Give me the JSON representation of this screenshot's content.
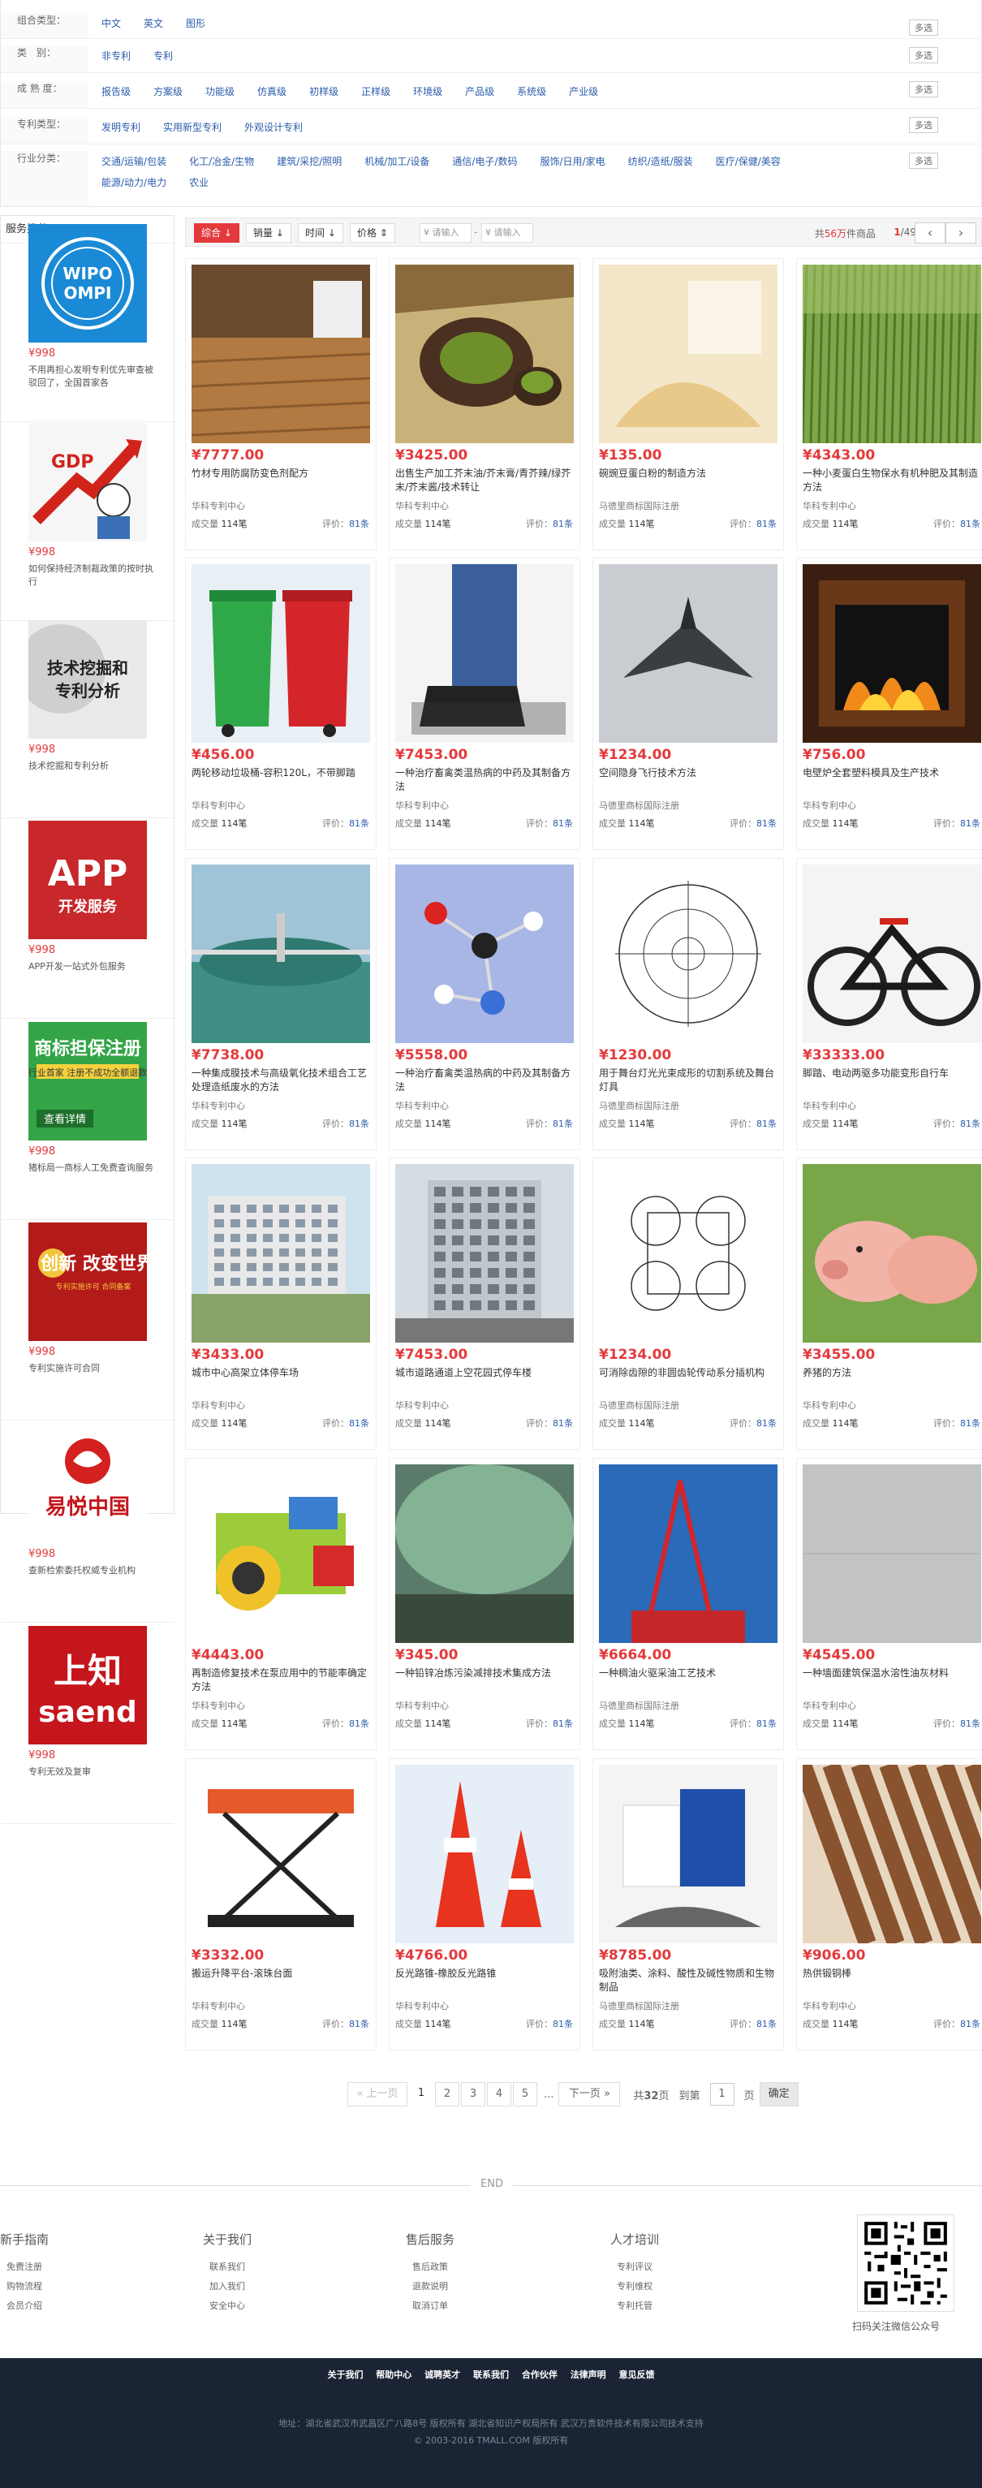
{
  "filters": {
    "rows": [
      {
        "label": "组合类型：",
        "options": [
          "中文",
          "英文",
          "图形"
        ],
        "more": "多选"
      },
      {
        "label": "类　别：",
        "options": [
          "非专利",
          "专利"
        ],
        "more": "多选"
      },
      {
        "label": "成 熟 度：",
        "options": [
          "报告级",
          "方案级",
          "功能级",
          "仿真级",
          "初样级",
          "正样级",
          "环境级",
          "产品级",
          "系统级",
          "产业级"
        ],
        "more": "多选"
      },
      {
        "label": "专利类型：",
        "options": [
          "发明专利",
          "实用新型专利",
          "外观设计专利"
        ],
        "more": "多选"
      },
      {
        "label": "行业分类：",
        "options": [
          "交通/运输/包装",
          "化工/冶金/生物",
          "建筑/采挖/照明",
          "机械/加工/设备",
          "通信/电子/数码",
          "服饰/日用/家电",
          "纺织/造纸/服装",
          "医疗/保健/美容",
          "能源/动力/电力",
          "农业"
        ],
        "more": "多选"
      }
    ]
  },
  "sidebar": {
    "title": "服务推荐",
    "items": [
      {
        "price": "¥998",
        "desc": "不用再担心发明专利优先审查被驳回了，全国首家各"
      },
      {
        "price": "¥998",
        "desc": "如何保持经济制裁政策的按时执行"
      },
      {
        "price": "¥998",
        "desc": "技术挖掘和专利分析"
      },
      {
        "price": "¥998",
        "desc": "APP开发一站式外包服务"
      },
      {
        "price": "¥998",
        "desc": "猪标局一商标人工免费查询服务"
      },
      {
        "price": "¥998",
        "desc": "专利实施许可合同"
      },
      {
        "price": "¥998",
        "desc": "查新检索委托权威专业机构"
      },
      {
        "price": "¥998",
        "desc": "专利无效及复审"
      }
    ],
    "images": [
      {
        "text": "WIPO OMPI",
        "bg": "#1a8ad6"
      },
      {
        "text": "GDP",
        "bg": "#f4f4f4"
      },
      {
        "text": "技术挖掘和专利分析",
        "bg": "#e8e8e8"
      },
      {
        "text": "APP 开发服务",
        "bg": "#c8282b"
      },
      {
        "text": "商标担保注册",
        "bg": "#2a9a3e"
      },
      {
        "text": "创新 改变世界",
        "bg": "#b31a1a"
      },
      {
        "text": "易悦中国",
        "bg": "#ffffff"
      },
      {
        "text": "上知 saend",
        "bg": "#c4161c"
      }
    ]
  },
  "toolbar": {
    "sort_comprehensive": "综合",
    "sort_sales": "销量",
    "sort_time": "时间",
    "sort_price": "价格",
    "price_min_placeholder": "¥ 请输入",
    "price_max_placeholder": "¥ 请输入",
    "count_prefix": "共",
    "count_value": "56万",
    "count_suffix": "件商品",
    "page_current": "1",
    "page_total": "/49",
    "prev": "‹",
    "next": "›"
  },
  "products": [
    {
      "price": "¥7777.00",
      "title": "竹材专用防腐防变色剂配方",
      "shop": "华科专利中心",
      "deals": "114笔",
      "rating": "81条",
      "img": "wood"
    },
    {
      "price": "¥3425.00",
      "title": "出售生产加工芥末油/芥末膏/青芥辣/绿芥末/芥末酱/技术转让",
      "shop": "华科专利中心",
      "deals": "114笔",
      "rating": "81条",
      "img": "matcha"
    },
    {
      "price": "¥135.00",
      "title": "碗豌豆蛋白粉的制造方法",
      "shop": "马德里商标国际注册",
      "deals": "114笔",
      "rating": "81条",
      "img": "powder"
    },
    {
      "price": "¥4343.00",
      "title": "一种小麦蛋白生物保水有机种肥及其制造方法",
      "shop": "华科专利中心",
      "deals": "114笔",
      "rating": "81条",
      "img": "wheat"
    },
    {
      "price": "¥456.00",
      "title": "两轮移动垃圾桶-容积120L，不带脚踏",
      "shop": "华科专利中心",
      "deals": "114笔",
      "rating": "81条",
      "img": "bins"
    },
    {
      "price": "¥7453.00",
      "title": "一种治疗畜禽类温热病的中药及其制备方法",
      "shop": "华科专利中心",
      "deals": "114笔",
      "rating": "81条",
      "img": "boots"
    },
    {
      "price": "¥1234.00",
      "title": "空间隐身飞行技术方法",
      "shop": "马德里商标国际注册",
      "deals": "114笔",
      "rating": "81条",
      "img": "jet"
    },
    {
      "price": "¥756.00",
      "title": "电壁炉全套塑料模具及生产技术",
      "shop": "华科专利中心",
      "deals": "114笔",
      "rating": "81条",
      "img": "fire"
    },
    {
      "price": "¥7738.00",
      "title": "一种集成膜技术与高级氧化技术组合工艺处理造纸废水的方法",
      "shop": "华科专利中心",
      "deals": "114笔",
      "rating": "81条",
      "img": "water"
    },
    {
      "price": "¥5558.00",
      "title": "一种治疗畜禽类温热病的中药及其制备方法",
      "shop": "华科专利中心",
      "deals": "114笔",
      "rating": "81条",
      "img": "molecule"
    },
    {
      "price": "¥1230.00",
      "title": "用于舞台灯光光束成形的切割系统及舞台灯具",
      "shop": "马德里商标国际注册",
      "deals": "114笔",
      "rating": "81条",
      "img": "drawing"
    },
    {
      "price": "¥33333.00",
      "title": "脚踏、电动两驱多功能变形自行车",
      "shop": "华科专利中心",
      "deals": "114笔",
      "rating": "81条",
      "img": "bike"
    },
    {
      "price": "¥3433.00",
      "title": "城市中心高架立体停车场",
      "shop": "华科专利中心",
      "deals": "114笔",
      "rating": "81条",
      "img": "building1"
    },
    {
      "price": "¥7453.00",
      "title": "城市道路通道上空花园式停车楼",
      "shop": "华科专利中心",
      "deals": "114笔",
      "rating": "81条",
      "img": "building2"
    },
    {
      "price": "¥1234.00",
      "title": "可消除齿隙的非圆齿轮传动系分插机构",
      "shop": "马德里商标国际注册",
      "deals": "114笔",
      "rating": "81条",
      "img": "gears"
    },
    {
      "price": "¥3455.00",
      "title": "养猪的方法",
      "shop": "华科专利中心",
      "deals": "114笔",
      "rating": "81条",
      "img": "pigs"
    },
    {
      "price": "¥4443.00",
      "title": "再制造修复技术在泵应用中的节能率确定方法",
      "shop": "华科专利中心",
      "deals": "114笔",
      "rating": "81条",
      "img": "pump"
    },
    {
      "price": "¥345.00",
      "title": "一种铅锌冶炼污染减排技术集成方法",
      "shop": "华科专利中心",
      "deals": "114笔",
      "rating": "81条",
      "img": "smoke"
    },
    {
      "price": "¥6664.00",
      "title": "一种稠油火驱采油工艺技术",
      "shop": "马德里商标国际注册",
      "deals": "114笔",
      "rating": "81条",
      "img": "rig"
    },
    {
      "price": "¥4545.00",
      "title": "一种墙面建筑保温水溶性油灰材料",
      "shop": "华科专利中心",
      "deals": "114笔",
      "rating": "81条",
      "img": "wall"
    },
    {
      "price": "¥3332.00",
      "title": "搬运升降平台-滚珠台面",
      "shop": "华科专利中心",
      "deals": "114笔",
      "rating": "81条",
      "img": "lift"
    },
    {
      "price": "¥4766.00",
      "title": "反光路锥-橡胶反光路锥",
      "shop": "华科专利中心",
      "deals": "114笔",
      "rating": "81条",
      "img": "cones"
    },
    {
      "price": "¥8785.00",
      "title": "吸附油类、涂料、酸性及碱性物质和生物制品",
      "shop": "马德里商标国际注册",
      "deals": "114笔",
      "rating": "81条",
      "img": "bags"
    },
    {
      "price": "¥906.00",
      "title": "热供锻铜棒",
      "shop": "华科专利中心",
      "deals": "114笔",
      "rating": "81条",
      "img": "rods"
    }
  ],
  "product_labels": {
    "deal_prefix": "成交量",
    "rating_prefix": "评价："
  },
  "pagination": {
    "prev": "上一页",
    "pages": [
      "1",
      "2",
      "3",
      "4",
      "5"
    ],
    "ellipsis": "...",
    "next": "下一页",
    "total_prefix": "共",
    "total_value": "32",
    "total_suffix": "页",
    "goto_prefix": "到第",
    "goto_value": "1",
    "goto_suffix": "页",
    "confirm": "确定"
  },
  "end_label": "END",
  "footer": {
    "columns": [
      {
        "title": "新手指南",
        "links": [
          "免费注册",
          "购物流程",
          "会员介绍"
        ]
      },
      {
        "title": "关于我们",
        "links": [
          "联系我们",
          "加入我们",
          "安全中心"
        ]
      },
      {
        "title": "售后服务",
        "links": [
          "售后政策",
          "退款说明",
          "取消订单"
        ]
      },
      {
        "title": "人才培训",
        "links": [
          "专利评议",
          "专利维权",
          "专利托管"
        ]
      }
    ],
    "qr_caption": "扫码关注微信公众号",
    "bottom_links": [
      "关于我们",
      "帮助中心",
      "诚聘英才",
      "联系我们",
      "合作伙伴",
      "法律声明",
      "意见反馈"
    ],
    "address": "地址：湖北省武汉市武昌区广八路8号 版权所有 湖北省知识产权局所有 武汉万贵软件技术有限公司技术支持",
    "copyright": "© 2003-2016 TMALL.COM 版权所有"
  },
  "colors": {
    "accent": "#e4393c",
    "link": "#2b5cab",
    "footer_bg": "#1b2434"
  }
}
